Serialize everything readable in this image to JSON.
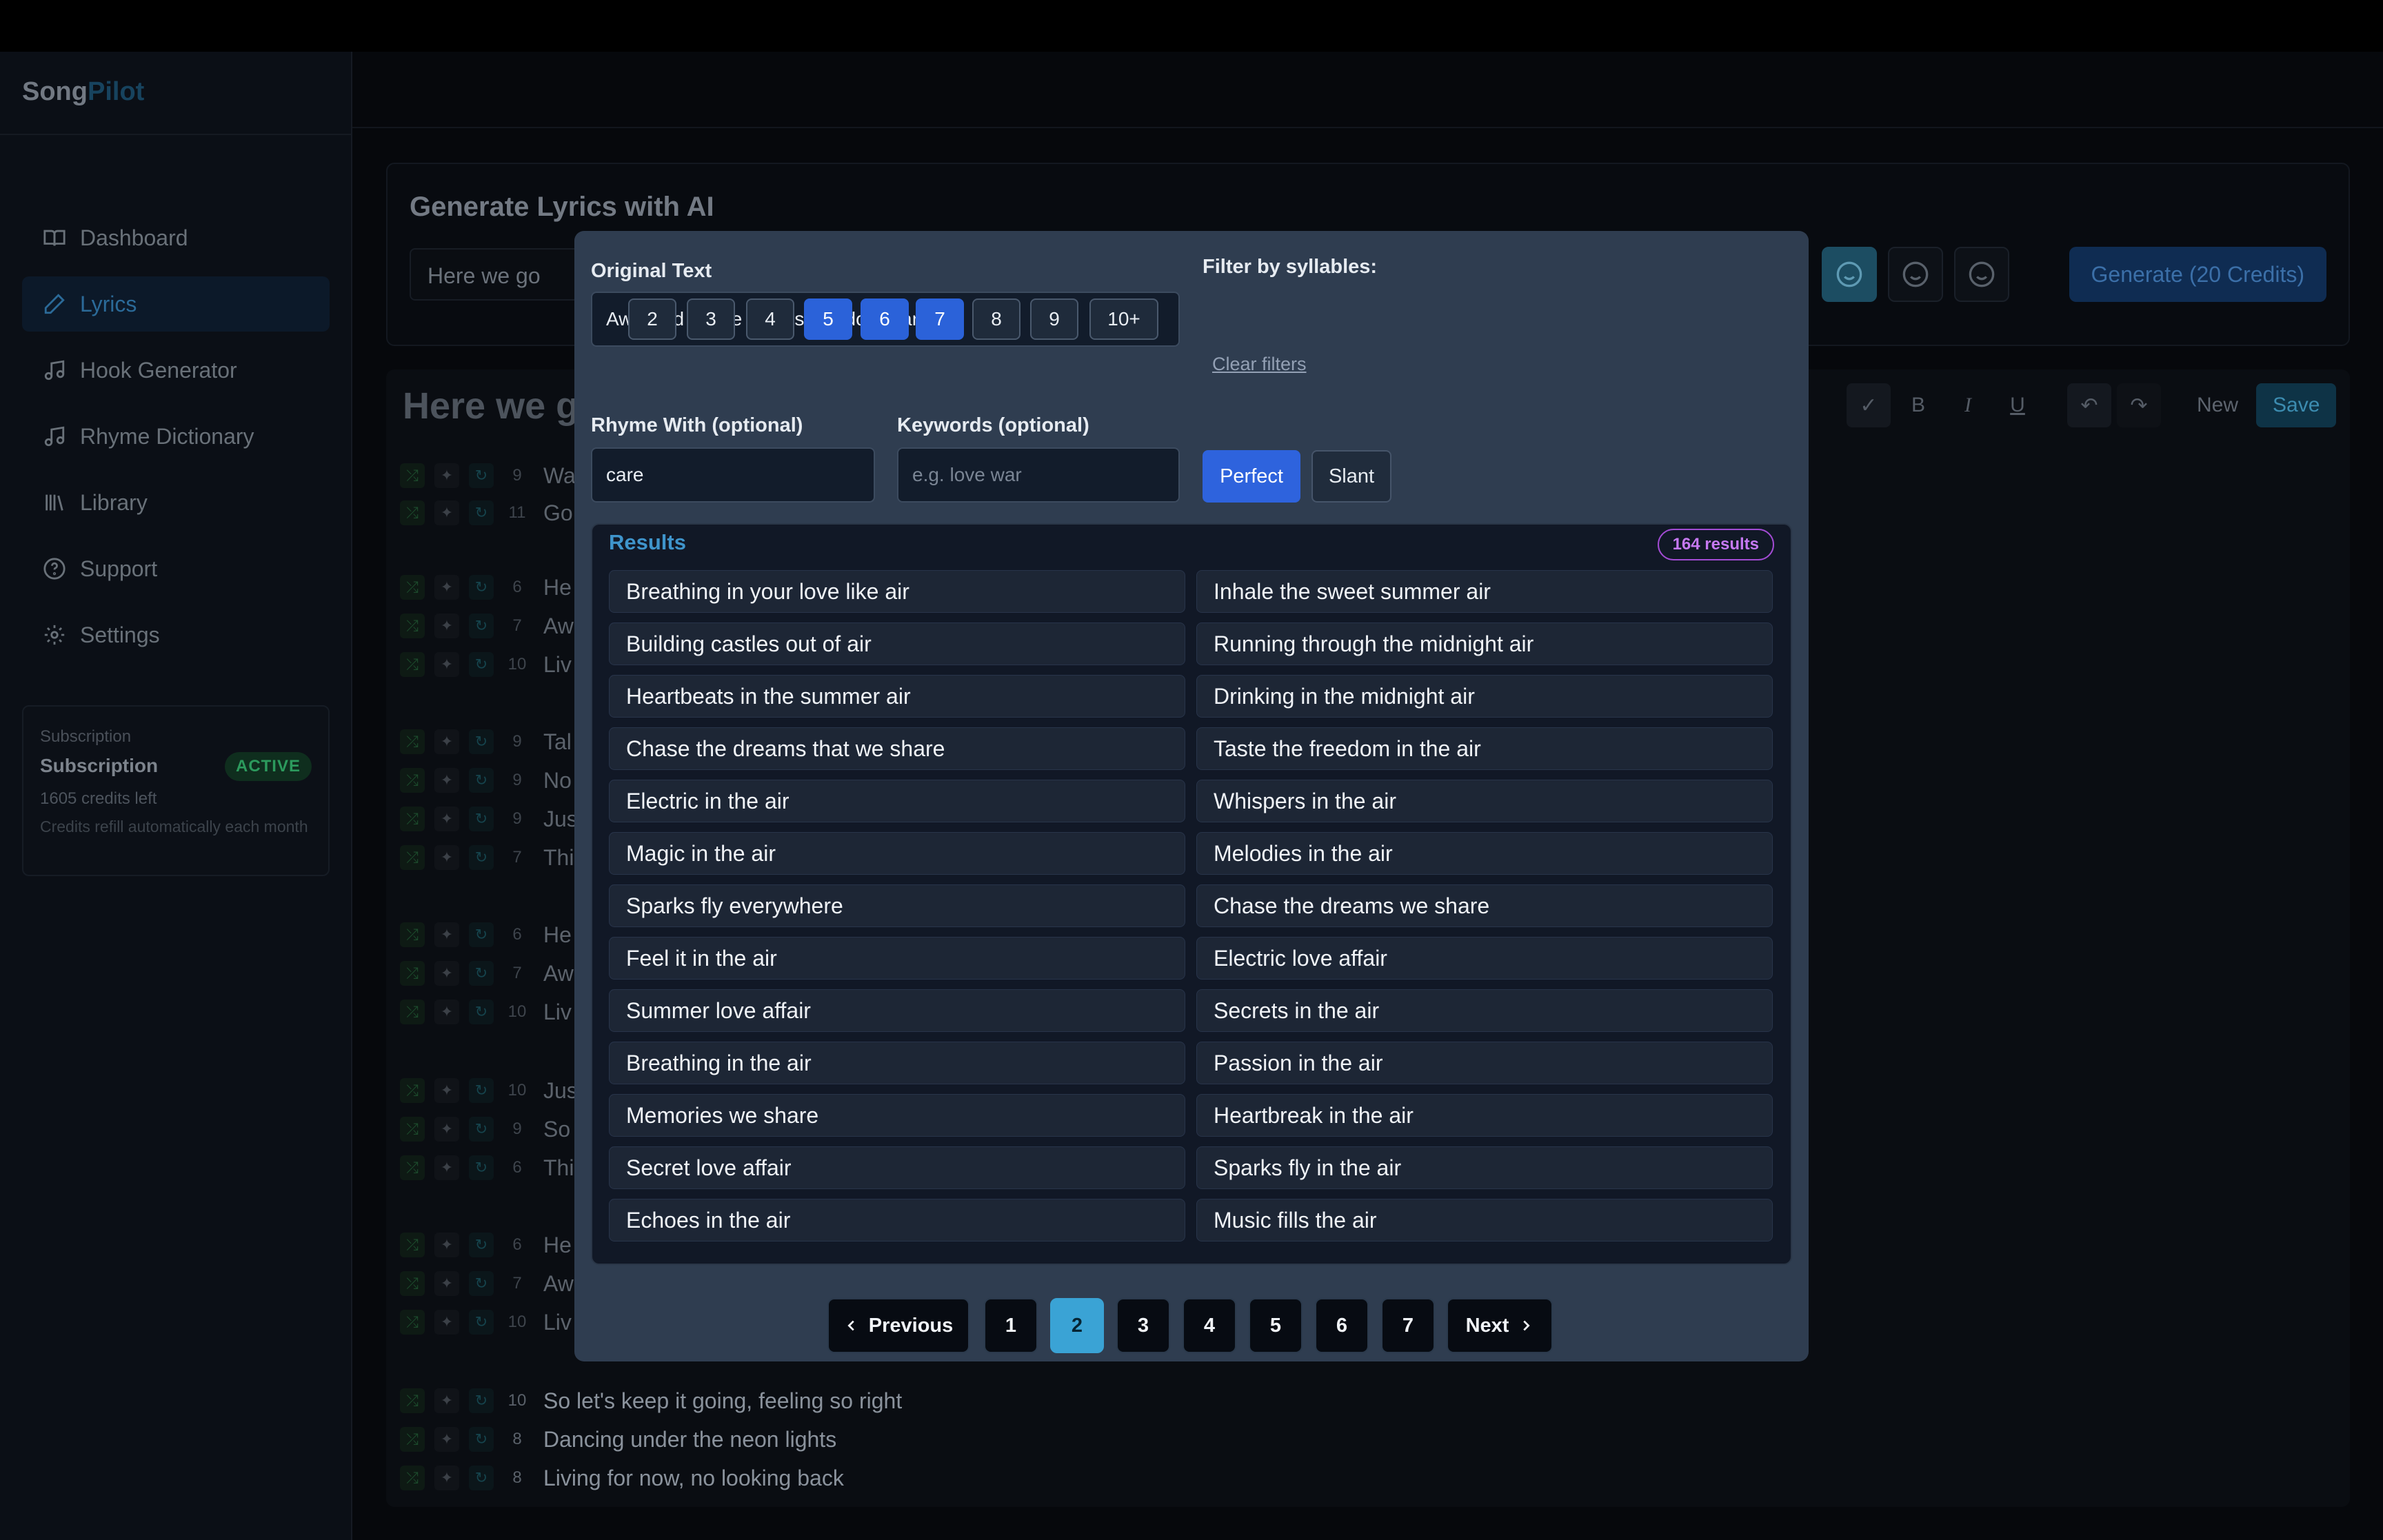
{
  "brand": {
    "part1": "Song",
    "part2": "Pilot"
  },
  "nav": [
    {
      "label": "Dashboard",
      "icon": "book-icon"
    },
    {
      "label": "Lyrics",
      "icon": "pen-icon"
    },
    {
      "label": "Hook Generator",
      "icon": "music-note-icon"
    },
    {
      "label": "Rhyme Dictionary",
      "icon": "music-note-icon"
    },
    {
      "label": "Library",
      "icon": "library-icon"
    },
    {
      "label": "Support",
      "icon": "help-circle-icon"
    },
    {
      "label": "Settings",
      "icon": "gear-icon"
    }
  ],
  "subscription": {
    "small_label": "Subscription",
    "title": "Subscription",
    "status": "ACTIVE",
    "credits": "1605 credits left",
    "note": "Credits refill automatically each month"
  },
  "generate": {
    "title": "Generate Lyrics with AI",
    "input_value": "Here we go",
    "button": "Generate (20 Credits)"
  },
  "editor": {
    "title": "Here we go",
    "toolbar": {
      "bold": "B",
      "italic": "I",
      "underline": "U",
      "new": "New",
      "save": "Save"
    },
    "rows": [
      {
        "n": "9",
        "t": "Wa"
      },
      {
        "n": "11",
        "t": "Go"
      },
      {
        "n": "6",
        "t": "He"
      },
      {
        "n": "7",
        "t": "Aw"
      },
      {
        "n": "10",
        "t": "Liv"
      },
      {
        "n": "9",
        "t": "Tal"
      },
      {
        "n": "9",
        "t": "No"
      },
      {
        "n": "9",
        "t": "Jus"
      },
      {
        "n": "7",
        "t": "Thi"
      },
      {
        "n": "6",
        "t": "He"
      },
      {
        "n": "7",
        "t": "Aw"
      },
      {
        "n": "10",
        "t": "Liv"
      },
      {
        "n": "10",
        "t": "Jus"
      },
      {
        "n": "9",
        "t": "So"
      },
      {
        "n": "6",
        "t": "Thi"
      },
      {
        "n": "6",
        "t": "He"
      },
      {
        "n": "7",
        "t": "Aw"
      },
      {
        "n": "10",
        "t": "Liv"
      },
      {
        "n": "10",
        "t": "So let's keep it going, feeling so right"
      },
      {
        "n": "8",
        "t": "Dancing under the neon lights"
      },
      {
        "n": "8",
        "t": "Living for now, no looking back"
      }
    ]
  },
  "modal": {
    "original_label": "Original Text",
    "original_value": "Awkward dance moves, we don't care",
    "filter_label": "Filter by syllables:",
    "syllables": [
      "2",
      "3",
      "4",
      "5",
      "6",
      "7",
      "8",
      "9",
      "10+"
    ],
    "selected_syllables": [
      "5",
      "6",
      "7"
    ],
    "clear_filters": "Clear filters",
    "rhyme_label": "Rhyme With (optional)",
    "rhyme_value": "care",
    "keywords_label": "Keywords (optional)",
    "keywords_placeholder": "e.g. love war",
    "perfect": "Perfect",
    "slant": "Slant",
    "results_title": "Results",
    "results_count": "164 results",
    "results": [
      "Breathing in your love like air",
      "Inhale the sweet summer air",
      "Building castles out of air",
      "Running through the midnight air",
      "Heartbeats in the summer air",
      "Drinking in the midnight air",
      "Chase the dreams that we share",
      "Taste the freedom in the air",
      "Electric in the air",
      "Whispers in the air",
      "Magic in the air",
      "Melodies in the air",
      "Sparks fly everywhere",
      "Chase the dreams we share",
      "Feel it in the air",
      "Electric love affair",
      "Summer love affair",
      "Secrets in the air",
      "Breathing in the air",
      "Passion in the air",
      "Memories we share",
      "Heartbreak in the air",
      "Secret love affair",
      "Sparks fly in the air",
      "Echoes in the air",
      "Music fills the air"
    ],
    "pagination": {
      "previous": "Previous",
      "next": "Next",
      "pages": [
        "1",
        "2",
        "3",
        "4",
        "5",
        "6",
        "7"
      ],
      "current": "2"
    }
  }
}
